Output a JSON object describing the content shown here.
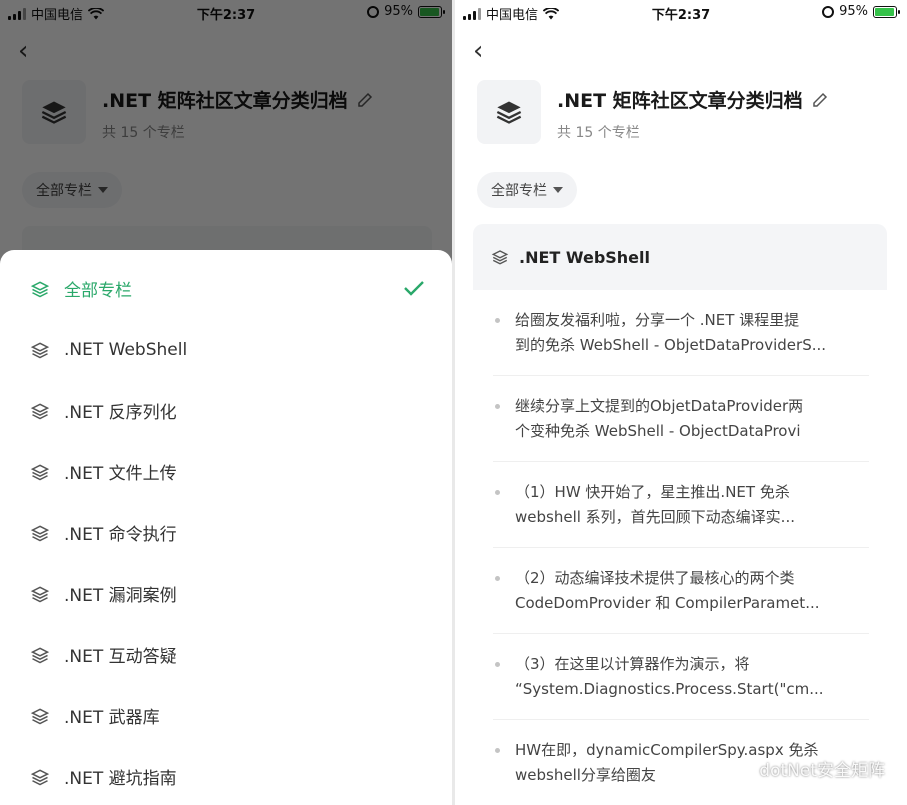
{
  "status_bar": {
    "carrier": "中国电信",
    "time": "下午2:37",
    "battery_percent": "95%",
    "battery_level": 0.95,
    "battery_color": "#35c24a"
  },
  "header": {
    "title": ".NET 矩阵社区文章分类归档",
    "count": "共 15 个专栏"
  },
  "filter": {
    "selected": "全部专栏"
  },
  "sheet": {
    "items": [
      {
        "label": "全部专栏",
        "active": true
      },
      {
        "label": ".NET WebShell",
        "active": false
      },
      {
        "label": ".NET 反序列化",
        "active": false
      },
      {
        "label": ".NET 文件上传",
        "active": false
      },
      {
        "label": ".NET 命令执行",
        "active": false
      },
      {
        "label": ".NET 漏洞案例",
        "active": false
      },
      {
        "label": ".NET 互动答疑",
        "active": false
      },
      {
        "label": ".NET 武器库",
        "active": false
      },
      {
        "label": ".NET 避坑指南",
        "active": false
      }
    ],
    "accent": "#2aa86a"
  },
  "column": {
    "name": ".NET WebShell",
    "articles": [
      {
        "line1": "给圈友发福利啦，分享一个 .NET 课程里提",
        "line2": "到的免杀 WebShell - ObjetDataProviderS..."
      },
      {
        "line1": "继续分享上文提到的ObjetDataProvider两",
        "line2": "个变种免杀 WebShell - ObjectDataProvi"
      },
      {
        "line1": "（1）HW 快开始了，星主推出.NET 免杀",
        "line2": "webshell 系列，首先回顾下动态编译实..."
      },
      {
        "line1": "（2）动态编译技术提供了最核心的两个类",
        "line2": "CodeDomProvider 和 CompilerParamet..."
      },
      {
        "line1": "（3）在这里以计算器作为演示，将",
        "line2": "“System.Diagnostics.Process.Start(\"cm..."
      },
      {
        "line1": "HW在即，dynamicCompilerSpy.aspx 免杀",
        "line2": "webshell分享给圈友"
      }
    ]
  },
  "watermark": "dotNet安全矩阵"
}
